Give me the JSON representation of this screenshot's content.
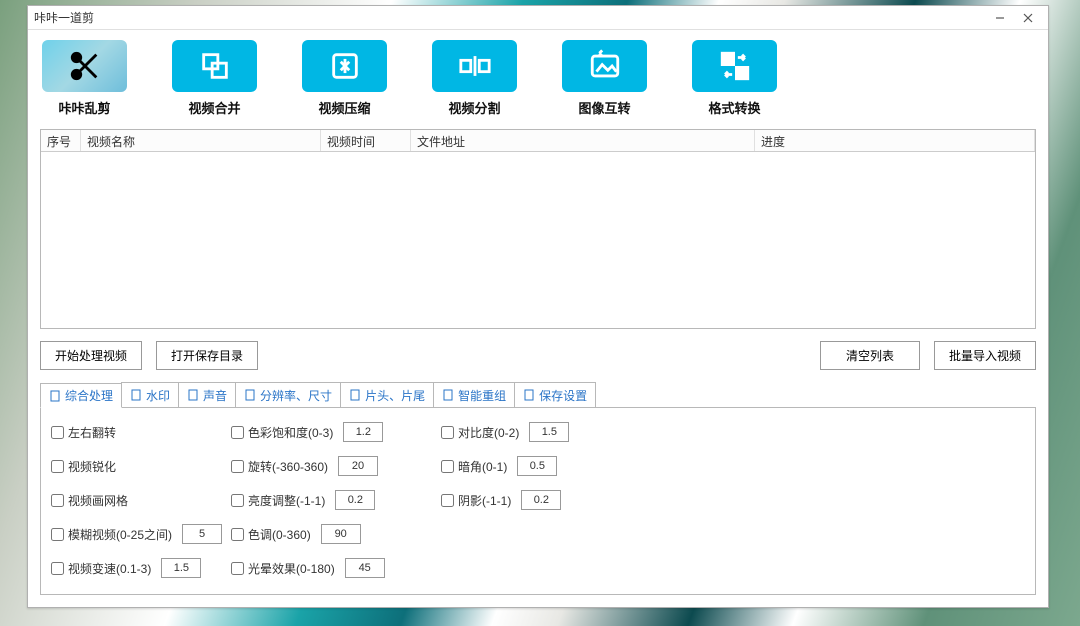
{
  "window": {
    "title": "咔咔一道剪"
  },
  "toolbar": {
    "items": [
      {
        "label": "咔咔乱剪"
      },
      {
        "label": "视频合并"
      },
      {
        "label": "视频压缩"
      },
      {
        "label": "视频分割"
      },
      {
        "label": "图像互转"
      },
      {
        "label": "格式转换"
      }
    ]
  },
  "table": {
    "headers": {
      "index": "序号",
      "name": "视频名称",
      "duration": "视频时间",
      "path": "文件地址",
      "progress": "进度"
    }
  },
  "buttons": {
    "start": "开始处理视频",
    "open_dir": "打开保存目录",
    "clear": "清空列表",
    "import": "批量导入视频"
  },
  "tabs": {
    "items": [
      "综合处理",
      "水印",
      "声音",
      "分辨率、尺寸",
      "片头、片尾",
      "智能重组",
      "保存设置"
    ]
  },
  "options": {
    "row1": {
      "a": "左右翻转",
      "b": "色彩饱和度(0-3)",
      "b_val": "1.2",
      "c": "对比度(0-2)",
      "c_val": "1.5"
    },
    "row2": {
      "a": "视频锐化",
      "b": "旋转(-360-360)",
      "b_val": "20",
      "c": "暗角(0-1)",
      "c_val": "0.5"
    },
    "row3": {
      "a": "视频画网格",
      "b": "亮度调整(-1-1)",
      "b_val": "0.2",
      "c": "阴影(-1-1)",
      "c_val": "0.2"
    },
    "row4": {
      "a": "模糊视频(0-25之间)",
      "a_val": "5",
      "b": "色调(0-360)",
      "b_val": "90"
    },
    "row5": {
      "a": "视频变速(0.1-3)",
      "a_val": "1.5",
      "b": "光晕效果(0-180)",
      "b_val": "45"
    }
  }
}
